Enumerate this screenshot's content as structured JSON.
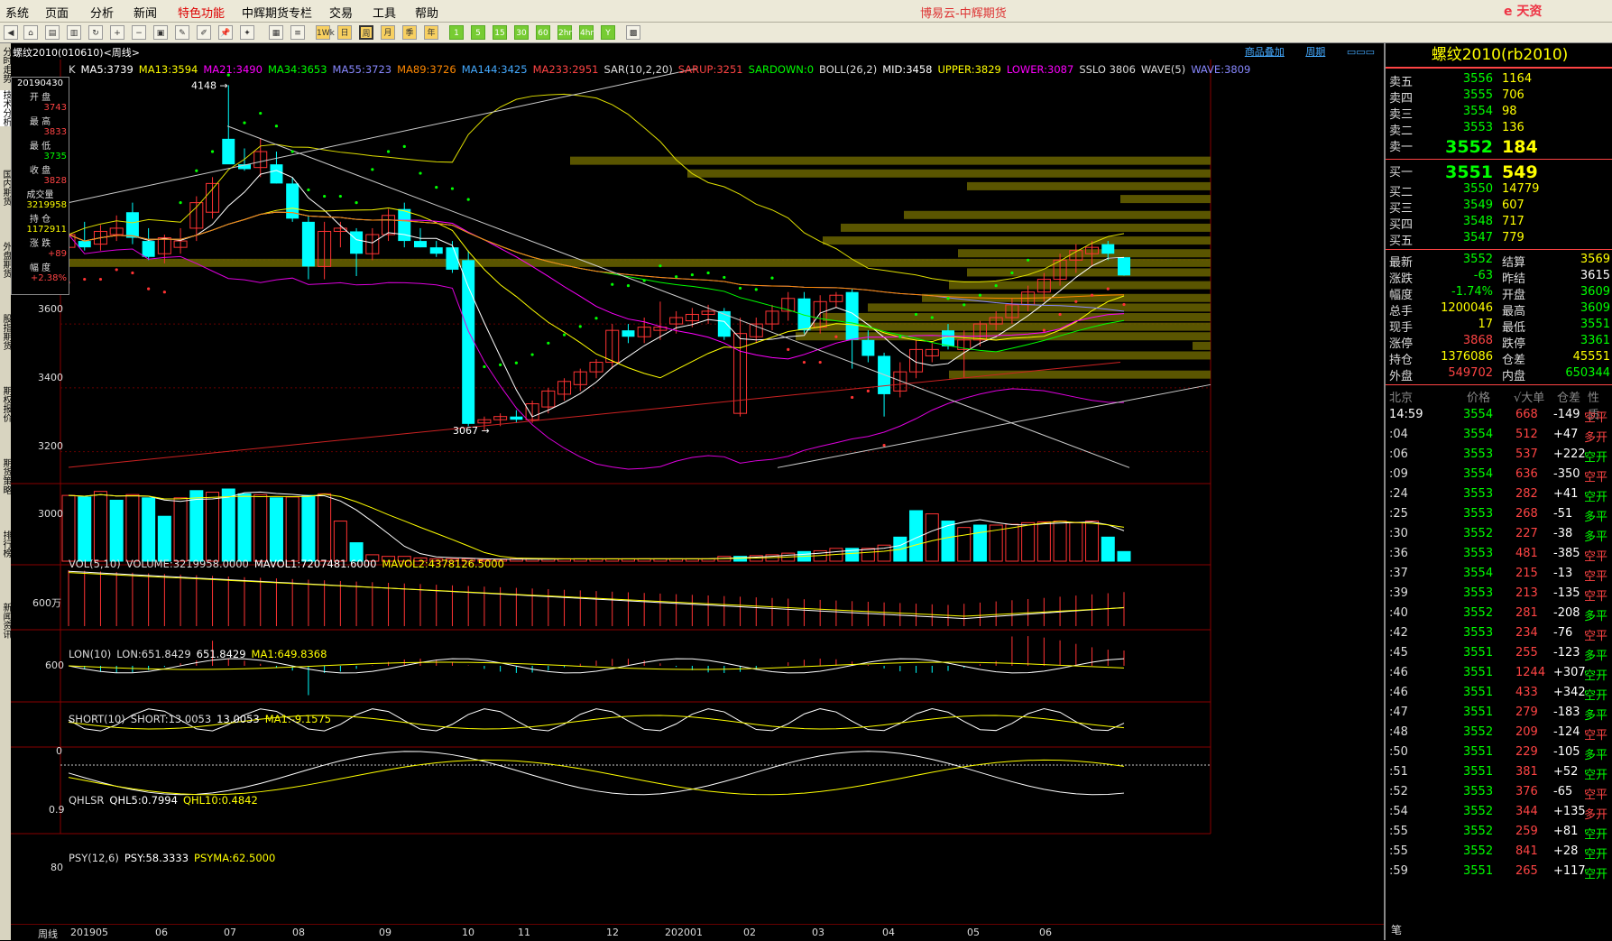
{
  "menu": {
    "items": [
      "系统",
      "页面",
      "分析",
      "新闻",
      "特色功能",
      "中辉期货专栏",
      "交易",
      "工具",
      "帮助"
    ],
    "app_title": "博易云-中辉期货",
    "logo": "e 天资"
  },
  "toolbar": {
    "buttons": [
      "1Wk",
      "日",
      "周",
      "月",
      "季",
      "年",
      "1",
      "5",
      "15",
      "30",
      "60",
      "2hr",
      "4hr",
      "Y"
    ]
  },
  "left_tabs": [
    "分时走势",
    "技术分析",
    "国内期货",
    "外盘期货",
    "股指期货",
    "期权报价",
    "期货策略",
    "排行榜",
    "新闻资讯"
  ],
  "chart_header": {
    "symbol_title": "螺纹2010(010610)<周线>",
    "link_overlay": "商品叠加",
    "link_period": "周期"
  },
  "info": {
    "date": "20190430",
    "open_label": "开 盘",
    "open": "3743",
    "high_label": "最 高",
    "high": "3833",
    "low_label": "最 低",
    "low": "3735",
    "close_label": "收 盘",
    "close": "3828",
    "vol_label": "成交量",
    "vol": "3219958",
    "oi_label": "持 仓",
    "oi": "1172911",
    "chg_label": "涨 跌",
    "chg": "+89",
    "pct_label": "幅 度",
    "pct": "+2.38%"
  },
  "indicators": {
    "main": [
      {
        "t": "K",
        "c": "#ddd"
      },
      {
        "t": "MA5:3739",
        "c": "#fff"
      },
      {
        "t": "MA13:3594",
        "c": "#ff0"
      },
      {
        "t": "MA21:3490",
        "c": "#f0f"
      },
      {
        "t": "MA34:3653",
        "c": "#0f0"
      },
      {
        "t": "MA55:3723",
        "c": "#88f"
      },
      {
        "t": "MA89:3726",
        "c": "#f80"
      },
      {
        "t": "MA144:3425",
        "c": "#4af"
      },
      {
        "t": "MA233:2951",
        "c": "#f44"
      },
      {
        "t": "SAR(10,2,20)",
        "c": "#ddd"
      },
      {
        "t": "SARUP:3251",
        "c": "#f44"
      },
      {
        "t": "SARDOWN:0",
        "c": "#0f0"
      },
      {
        "t": "BOLL(26,2)",
        "c": "#ddd"
      },
      {
        "t": "MID:3458",
        "c": "#fff"
      },
      {
        "t": "UPPER:3829",
        "c": "#ff0"
      },
      {
        "t": "LOWER:3087",
        "c": "#f0f"
      },
      {
        "t": "SSLO 3806",
        "c": "#ddd"
      },
      {
        "t": "WAVE(5)",
        "c": "#ddd"
      },
      {
        "t": "WAVE:3809",
        "c": "#88f"
      }
    ],
    "vol": [
      {
        "t": "VOL(5,10)",
        "c": "#ddd"
      },
      {
        "t": "VOLUME:3219958.0000",
        "c": "#ddd"
      },
      {
        "t": "MAVOL1:7207481.6000",
        "c": "#fff"
      },
      {
        "t": "MAVOL2:4378126.5000",
        "c": "#ff0"
      }
    ],
    "lon": [
      {
        "t": "LON(10)",
        "c": "#ddd"
      },
      {
        "t": "LON:651.8429",
        "c": "#ddd"
      },
      {
        "t": "651.8429",
        "c": "#fff"
      },
      {
        "t": "MA1:649.8368",
        "c": "#ff0"
      }
    ],
    "short": [
      {
        "t": "SHORT(10)",
        "c": "#ddd"
      },
      {
        "t": "SHORT:13.0053",
        "c": "#ddd"
      },
      {
        "t": "13.0053",
        "c": "#fff"
      },
      {
        "t": "MA1:-9.1575",
        "c": "#ff0"
      }
    ],
    "qhl": [
      {
        "t": "QHLSR",
        "c": "#ddd"
      },
      {
        "t": "QHL5:0.7994",
        "c": "#fff"
      },
      {
        "t": "QHL10:0.4842",
        "c": "#ff0"
      }
    ],
    "psy": [
      {
        "t": "PSY(12,6)",
        "c": "#ddd"
      },
      {
        "t": "PSY:58.3333",
        "c": "#fff"
      },
      {
        "t": "PSYMA:62.5000",
        "c": "#ff0"
      }
    ]
  },
  "yaxis": {
    "main": [
      "3600",
      "3400",
      "3200",
      "3000"
    ],
    "vol": "600万",
    "lon": "600",
    "short": "0",
    "qhl": "0.9",
    "psy": "80"
  },
  "annotations": {
    "high": "4148",
    "low": "3067"
  },
  "xaxis": {
    "period_label": "周线",
    "dates": [
      "201905",
      "06",
      "07",
      "08",
      "09",
      "10",
      "11",
      "12",
      "202001",
      "02",
      "03",
      "04",
      "05",
      "06"
    ]
  },
  "quote": {
    "title": "螺纹2010(rb2010)",
    "asks": [
      {
        "l": "卖五",
        "p": "3556",
        "v": "1164"
      },
      {
        "l": "卖四",
        "p": "3555",
        "v": "706"
      },
      {
        "l": "卖三",
        "p": "3554",
        "v": "98"
      },
      {
        "l": "卖二",
        "p": "3553",
        "v": "136"
      },
      {
        "l": "卖一",
        "p": "3552",
        "v": "184"
      }
    ],
    "bids": [
      {
        "l": "买一",
        "p": "3551",
        "v": "549"
      },
      {
        "l": "买二",
        "p": "3550",
        "v": "14779"
      },
      {
        "l": "买三",
        "p": "3549",
        "v": "607"
      },
      {
        "l": "买四",
        "p": "3548",
        "v": "717"
      },
      {
        "l": "买五",
        "p": "3547",
        "v": "779"
      }
    ],
    "stats": [
      {
        "l": "最新",
        "v": "3552",
        "vc": "#0f0",
        "l2": "结算",
        "v2": "3569",
        "v2c": "#ff0"
      },
      {
        "l": "涨跌",
        "v": "-63",
        "vc": "#0f0",
        "l2": "昨结",
        "v2": "3615",
        "v2c": "#fff"
      },
      {
        "l": "幅度",
        "v": "-1.74%",
        "vc": "#0f0",
        "l2": "开盘",
        "v2": "3609",
        "v2c": "#0f0"
      },
      {
        "l": "总手",
        "v": "1200046",
        "vc": "#ff0",
        "l2": "最高",
        "v2": "3609",
        "v2c": "#0f0"
      },
      {
        "l": "现手",
        "v": "17",
        "vc": "#ff0",
        "l2": "最低",
        "v2": "3551",
        "v2c": "#0f0"
      },
      {
        "l": "涨停",
        "v": "3868",
        "vc": "#f44",
        "l2": "跌停",
        "v2": "3361",
        "v2c": "#0f0"
      },
      {
        "l": "持仓",
        "v": "1376086",
        "vc": "#ff0",
        "l2": "仓差",
        "v2": "45551",
        "v2c": "#ff0"
      },
      {
        "l": "外盘",
        "v": "549702",
        "vc": "#f44",
        "l2": "内盘",
        "v2": "650344",
        "v2c": "#0f0"
      }
    ],
    "tick_header": {
      "loc": "北京",
      "price": "价格",
      "big": "√大单",
      "diff": "仓差",
      "nature": "性质"
    },
    "ticks": [
      {
        "t": "14:59",
        "p": "3554",
        "v": "668",
        "d": "-149",
        "n": "空平",
        "nc": "#f44"
      },
      {
        "t": ":04",
        "p": "3554",
        "v": "512",
        "d": "+47",
        "n": "多开",
        "nc": "#f44"
      },
      {
        "t": ":06",
        "p": "3553",
        "v": "537",
        "d": "+222",
        "n": "空开",
        "nc": "#0f0"
      },
      {
        "t": ":09",
        "p": "3554",
        "v": "636",
        "d": "-350",
        "n": "空平",
        "nc": "#f44"
      },
      {
        "t": ":24",
        "p": "3553",
        "v": "282",
        "d": "+41",
        "n": "空开",
        "nc": "#0f0"
      },
      {
        "t": ":25",
        "p": "3553",
        "v": "268",
        "d": "-51",
        "n": "多平",
        "nc": "#0f0"
      },
      {
        "t": ":30",
        "p": "3552",
        "v": "227",
        "d": "-38",
        "n": "多平",
        "nc": "#0f0"
      },
      {
        "t": ":36",
        "p": "3553",
        "v": "481",
        "d": "-385",
        "n": "空平",
        "nc": "#f44"
      },
      {
        "t": ":37",
        "p": "3554",
        "v": "215",
        "d": "-13",
        "n": "空平",
        "nc": "#f44"
      },
      {
        "t": ":39",
        "p": "3553",
        "v": "213",
        "d": "-135",
        "n": "空平",
        "nc": "#f44"
      },
      {
        "t": ":40",
        "p": "3552",
        "v": "281",
        "d": "-208",
        "n": "多平",
        "nc": "#0f0"
      },
      {
        "t": ":42",
        "p": "3553",
        "v": "234",
        "d": "-76",
        "n": "空平",
        "nc": "#f44"
      },
      {
        "t": ":45",
        "p": "3551",
        "v": "255",
        "d": "-123",
        "n": "多平",
        "nc": "#0f0"
      },
      {
        "t": ":46",
        "p": "3551",
        "v": "1244",
        "d": "+307",
        "n": "空开",
        "nc": "#0f0"
      },
      {
        "t": ":46",
        "p": "3551",
        "v": "433",
        "d": "+342",
        "n": "空开",
        "nc": "#0f0"
      },
      {
        "t": ":47",
        "p": "3551",
        "v": "279",
        "d": "-183",
        "n": "多平",
        "nc": "#0f0"
      },
      {
        "t": ":48",
        "p": "3552",
        "v": "209",
        "d": "-124",
        "n": "空平",
        "nc": "#f44"
      },
      {
        "t": ":50",
        "p": "3551",
        "v": "229",
        "d": "-105",
        "n": "多平",
        "nc": "#0f0"
      },
      {
        "t": ":51",
        "p": "3551",
        "v": "381",
        "d": "+52",
        "n": "空开",
        "nc": "#0f0"
      },
      {
        "t": ":52",
        "p": "3553",
        "v": "376",
        "d": "-65",
        "n": "空平",
        "nc": "#f44"
      },
      {
        "t": ":54",
        "p": "3552",
        "v": "344",
        "d": "+135",
        "n": "多开",
        "nc": "#f44"
      },
      {
        "t": ":55",
        "p": "3552",
        "v": "259",
        "d": "+81",
        "n": "空开",
        "nc": "#0f0"
      },
      {
        "t": ":55",
        "p": "3552",
        "v": "841",
        "d": "+28",
        "n": "空开",
        "nc": "#0f0"
      },
      {
        "t": ":59",
        "p": "3551",
        "v": "265",
        "d": "+117",
        "n": "空开",
        "nc": "#0f0"
      }
    ],
    "bottom_label": "笔"
  },
  "chart_data": {
    "type": "candlestick",
    "ylim": [
      2900,
      4200
    ],
    "candles": [
      {
        "o": 3640,
        "h": 3700,
        "l": 3620,
        "c": 3680,
        "up": true
      },
      {
        "o": 3660,
        "h": 3720,
        "l": 3630,
        "c": 3640,
        "up": false
      },
      {
        "o": 3650,
        "h": 3710,
        "l": 3630,
        "c": 3690,
        "up": true
      },
      {
        "o": 3680,
        "h": 3740,
        "l": 3660,
        "c": 3700,
        "up": true
      },
      {
        "o": 3750,
        "h": 3780,
        "l": 3650,
        "c": 3670,
        "up": false
      },
      {
        "o": 3660,
        "h": 3700,
        "l": 3600,
        "c": 3610,
        "up": false
      },
      {
        "o": 3620,
        "h": 3680,
        "l": 3590,
        "c": 3670,
        "up": true
      },
      {
        "o": 3640,
        "h": 3700,
        "l": 3620,
        "c": 3660,
        "up": true
      },
      {
        "o": 3700,
        "h": 3800,
        "l": 3660,
        "c": 3780,
        "up": true
      },
      {
        "o": 3750,
        "h": 3860,
        "l": 3730,
        "c": 3840,
        "up": true
      },
      {
        "o": 3980,
        "h": 4148,
        "l": 3950,
        "c": 3900,
        "up": false
      },
      {
        "o": 3900,
        "h": 3950,
        "l": 3880,
        "c": 3885,
        "up": false
      },
      {
        "o": 3890,
        "h": 3980,
        "l": 3860,
        "c": 3940,
        "up": true
      },
      {
        "o": 3900,
        "h": 3940,
        "l": 3840,
        "c": 3840,
        "up": false
      },
      {
        "o": 3840,
        "h": 3860,
        "l": 3720,
        "c": 3730,
        "up": false
      },
      {
        "o": 3720,
        "h": 3740,
        "l": 3540,
        "c": 3580,
        "up": false
      },
      {
        "o": 3580,
        "h": 3720,
        "l": 3540,
        "c": 3690,
        "up": true
      },
      {
        "o": 3690,
        "h": 3720,
        "l": 3640,
        "c": 3700,
        "up": true
      },
      {
        "o": 3690,
        "h": 3700,
        "l": 3550,
        "c": 3620,
        "up": false
      },
      {
        "o": 3620,
        "h": 3700,
        "l": 3600,
        "c": 3680,
        "up": true
      },
      {
        "o": 3680,
        "h": 3760,
        "l": 3660,
        "c": 3740,
        "up": true
      },
      {
        "o": 3760,
        "h": 3780,
        "l": 3640,
        "c": 3660,
        "up": false
      },
      {
        "o": 3660,
        "h": 3700,
        "l": 3640,
        "c": 3640,
        "up": false
      },
      {
        "o": 3640,
        "h": 3660,
        "l": 3610,
        "c": 3620,
        "up": false
      },
      {
        "o": 3640,
        "h": 3660,
        "l": 3560,
        "c": 3570,
        "up": false
      },
      {
        "o": 3600,
        "h": 3630,
        "l": 3080,
        "c": 3087,
        "up": false
      },
      {
        "o": 3090,
        "h": 3110,
        "l": 3067,
        "c": 3100,
        "up": true
      },
      {
        "o": 3100,
        "h": 3120,
        "l": 3080,
        "c": 3110,
        "up": true
      },
      {
        "o": 3110,
        "h": 3130,
        "l": 3090,
        "c": 3100,
        "up": false
      },
      {
        "o": 3100,
        "h": 3160,
        "l": 3090,
        "c": 3150,
        "up": true
      },
      {
        "o": 3140,
        "h": 3200,
        "l": 3120,
        "c": 3190,
        "up": true
      },
      {
        "o": 3180,
        "h": 3230,
        "l": 3160,
        "c": 3220,
        "up": true
      },
      {
        "o": 3210,
        "h": 3260,
        "l": 3190,
        "c": 3250,
        "up": true
      },
      {
        "o": 3250,
        "h": 3290,
        "l": 3230,
        "c": 3280,
        "up": true
      },
      {
        "o": 3280,
        "h": 3400,
        "l": 3260,
        "c": 3380,
        "up": true
      },
      {
        "o": 3380,
        "h": 3400,
        "l": 3340,
        "c": 3360,
        "up": false
      },
      {
        "o": 3360,
        "h": 3420,
        "l": 3340,
        "c": 3390,
        "up": true
      },
      {
        "o": 3380,
        "h": 3470,
        "l": 3350,
        "c": 3390,
        "up": true
      },
      {
        "o": 3400,
        "h": 3440,
        "l": 3370,
        "c": 3420,
        "up": true
      },
      {
        "o": 3410,
        "h": 3450,
        "l": 3390,
        "c": 3430,
        "up": true
      },
      {
        "o": 3430,
        "h": 3460,
        "l": 3400,
        "c": 3440,
        "up": true
      },
      {
        "o": 3440,
        "h": 3450,
        "l": 3350,
        "c": 3360,
        "up": false
      },
      {
        "o": 3370,
        "h": 3420,
        "l": 3110,
        "c": 3120,
        "up": true
      },
      {
        "o": 3360,
        "h": 3420,
        "l": 3340,
        "c": 3400,
        "up": true
      },
      {
        "o": 3400,
        "h": 3460,
        "l": 3380,
        "c": 3440,
        "up": true
      },
      {
        "o": 3440,
        "h": 3500,
        "l": 3410,
        "c": 3480,
        "up": true
      },
      {
        "o": 3480,
        "h": 3500,
        "l": 3370,
        "c": 3380,
        "up": false
      },
      {
        "o": 3390,
        "h": 3490,
        "l": 3370,
        "c": 3470,
        "up": true
      },
      {
        "o": 3470,
        "h": 3500,
        "l": 3450,
        "c": 3490,
        "up": true
      },
      {
        "o": 3500,
        "h": 3510,
        "l": 3260,
        "c": 3350,
        "up": false
      },
      {
        "o": 3350,
        "h": 3380,
        "l": 3280,
        "c": 3300,
        "up": false
      },
      {
        "o": 3300,
        "h": 3310,
        "l": 3110,
        "c": 3180,
        "up": false
      },
      {
        "o": 3190,
        "h": 3280,
        "l": 3170,
        "c": 3250,
        "up": true
      },
      {
        "o": 3250,
        "h": 3350,
        "l": 3230,
        "c": 3320,
        "up": true
      },
      {
        "o": 3320,
        "h": 3340,
        "l": 3280,
        "c": 3300,
        "up": true
      },
      {
        "o": 3380,
        "h": 3400,
        "l": 3320,
        "c": 3330,
        "up": false
      },
      {
        "o": 3320,
        "h": 3380,
        "l": 3230,
        "c": 3350,
        "up": true
      },
      {
        "o": 3350,
        "h": 3410,
        "l": 3330,
        "c": 3400,
        "up": true
      },
      {
        "o": 3400,
        "h": 3440,
        "l": 3380,
        "c": 3420,
        "up": true
      },
      {
        "o": 3420,
        "h": 3480,
        "l": 3400,
        "c": 3460,
        "up": true
      },
      {
        "o": 3460,
        "h": 3520,
        "l": 3440,
        "c": 3500,
        "up": true
      },
      {
        "o": 3500,
        "h": 3560,
        "l": 3470,
        "c": 3540,
        "up": true
      },
      {
        "o": 3540,
        "h": 3620,
        "l": 3520,
        "c": 3600,
        "up": true
      },
      {
        "o": 3600,
        "h": 3650,
        "l": 3560,
        "c": 3630,
        "up": true
      },
      {
        "o": 3620,
        "h": 3660,
        "l": 3580,
        "c": 3640,
        "up": true
      },
      {
        "o": 3650,
        "h": 3660,
        "l": 3600,
        "c": 3620,
        "up": false
      },
      {
        "o": 3609,
        "h": 3609,
        "l": 3551,
        "c": 3552,
        "up": false
      }
    ],
    "volume": [
      820,
      800,
      870,
      760,
      830,
      790,
      560,
      790,
      880,
      860,
      900,
      840,
      830,
      790,
      800,
      820,
      840,
      500,
      230,
      80,
      60,
      60,
      40,
      30,
      30,
      30,
      20,
      20,
      30,
      30,
      30,
      30,
      30,
      30,
      30,
      30,
      30,
      30,
      30,
      30,
      30,
      60,
      60,
      70,
      80,
      100,
      120,
      130,
      160,
      160,
      160,
      200,
      300,
      630,
      590,
      500,
      420,
      450,
      450,
      460,
      480,
      490,
      500,
      480,
      500,
      300,
      120
    ],
    "vol_color_up": [
      0,
      1,
      0,
      1,
      0,
      1,
      1,
      0,
      1,
      0,
      1,
      1,
      0,
      1,
      0,
      1,
      0,
      0,
      1,
      0,
      0,
      0,
      0,
      0,
      0,
      0,
      0,
      0,
      0,
      0,
      0,
      0,
      0,
      0,
      0,
      0,
      0,
      0,
      0,
      0,
      0,
      0,
      1,
      0,
      0,
      0,
      1,
      0,
      0,
      1,
      0,
      0,
      1,
      1,
      0,
      1,
      0,
      1,
      0,
      0,
      0,
      0,
      0,
      0,
      0,
      1,
      1
    ]
  }
}
